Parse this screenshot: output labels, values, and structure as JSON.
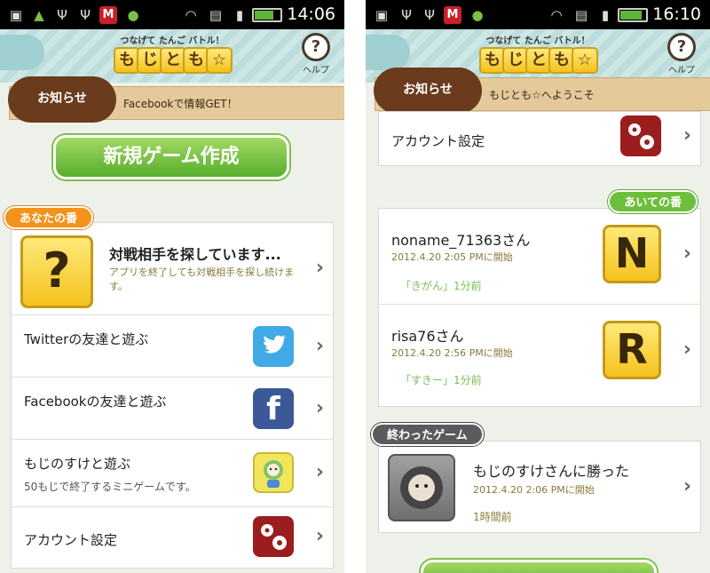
{
  "screen1": {
    "clock": "14:06",
    "logo_sub": "つなげて たんご バトル！",
    "logo_chars": [
      "も",
      "じ",
      "と",
      "も",
      "☆"
    ],
    "help": "ヘルプ",
    "notice_badge": "お知らせ",
    "notice_text": "Facebookで情報GET！",
    "new_game": "新規ゲーム作成",
    "your_turn": "あなたの番",
    "search_title": "対戦相手を探しています...",
    "search_sub": "アプリを終了しても対戦相手を探し続けます。",
    "twitter": "Twitterの友達と遊ぶ",
    "facebook": "Facebookの友達と遊ぶ",
    "mojinosuke": "もじのすけと遊ぶ",
    "mojinosuke_sub": "50もじで終了するミニゲームです。",
    "account": "アカウント設定",
    "chevron": "›",
    "q_mark": "?"
  },
  "screen2": {
    "clock": "16:10",
    "logo_sub": "つなげて たんご バトル！",
    "logo_chars": [
      "も",
      "じ",
      "と",
      "も",
      "☆"
    ],
    "help": "ヘルプ",
    "notice_badge": "お知らせ",
    "notice_text": "もじとも☆へようこそ",
    "account": "アカウント設定",
    "their_turn": "あいての番",
    "game1_name": "noname_71363さん",
    "game1_date": "2012.4.20 2:05 PMに開始",
    "game1_last": "「きがん」1分前",
    "game1_letter": "N",
    "game2_name": "risa76さん",
    "game2_date": "2012.4.20 2:56 PMに開始",
    "game2_last": "「すきー」1分前",
    "game2_letter": "R",
    "finished": "終わったゲーム",
    "game3_name": "もじのすけさんに勝った",
    "game3_date": "2012.4.20 2:06 PMに開始",
    "game3_last": "1時間前",
    "chevron": "›"
  },
  "colors": {
    "header_teal": "#bcdddc",
    "notice_brown": "#6a3b1c",
    "green_button": "#57ad2c",
    "orange_tag": "#f2931c",
    "green_tag": "#6cbf3a",
    "gray_tag": "#5b5b5b",
    "tile_yellow": "#f4c21d"
  }
}
